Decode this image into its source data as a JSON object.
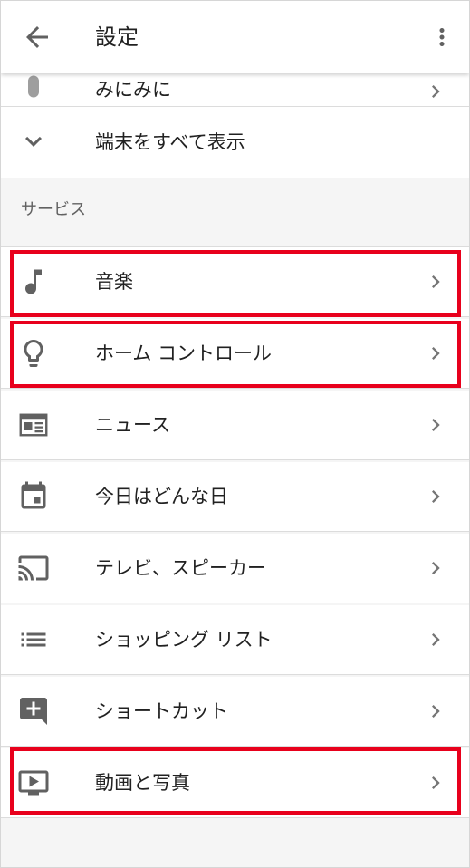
{
  "appbar": {
    "title": "設定",
    "back_icon": "arrow-back-icon",
    "more_icon": "more-vert-icon"
  },
  "devices": {
    "partial_item_label": "みにみに",
    "show_all_label": "端末をすべて表示"
  },
  "services": {
    "header": "サービス",
    "items": [
      {
        "label": "音楽",
        "icon": "music-note-icon",
        "highlighted": true
      },
      {
        "label": "ホーム コントロール",
        "icon": "lightbulb-icon",
        "highlighted": true
      },
      {
        "label": "ニュース",
        "icon": "newspaper-icon",
        "highlighted": false
      },
      {
        "label": "今日はどんな日",
        "icon": "calendar-icon",
        "highlighted": false
      },
      {
        "label": "テレビ、スピーカー",
        "icon": "cast-icon",
        "highlighted": false
      },
      {
        "label": "ショッピング リスト",
        "icon": "list-icon",
        "highlighted": false
      },
      {
        "label": "ショートカット",
        "icon": "add-comment-icon",
        "highlighted": false
      },
      {
        "label": "動画と写真",
        "icon": "video-play-icon",
        "highlighted": true
      }
    ]
  },
  "colors": {
    "highlight": "#e8001c",
    "icon": "#616161"
  }
}
